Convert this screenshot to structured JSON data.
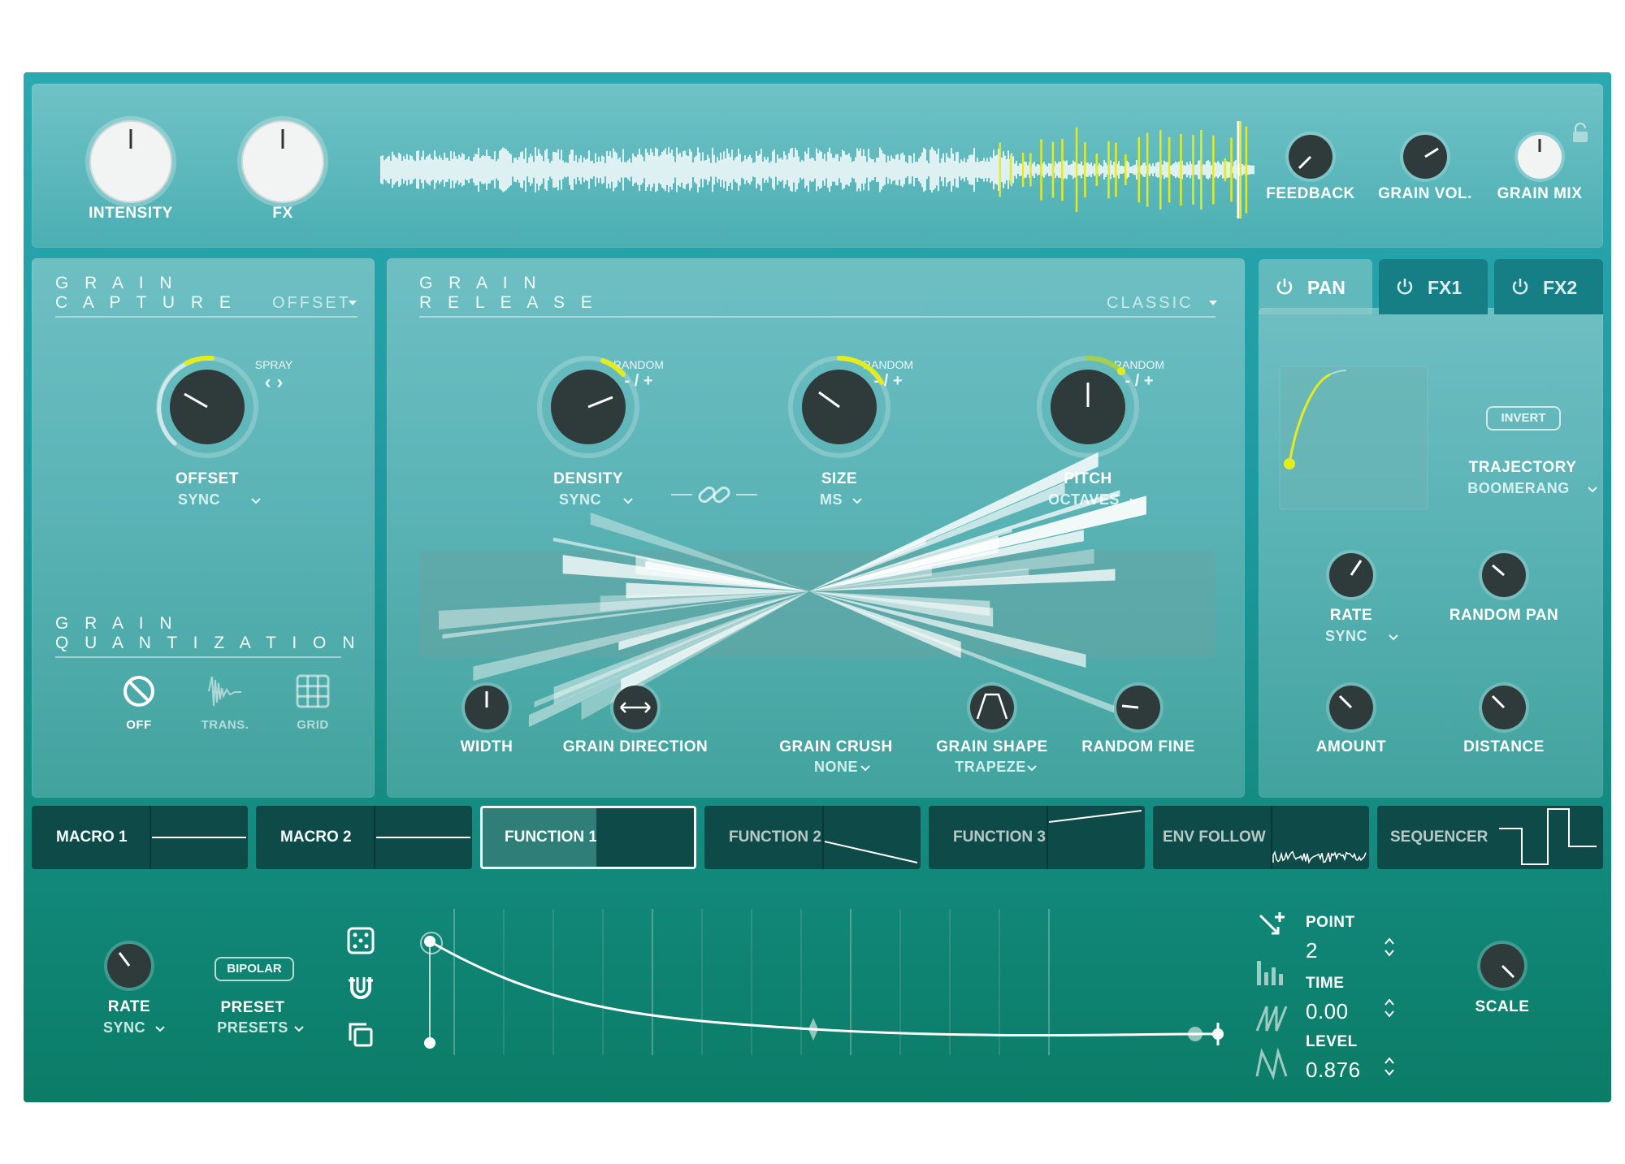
{
  "top": {
    "knobs_left": [
      {
        "label": "INTENSITY"
      },
      {
        "label": "FX"
      }
    ],
    "knobs_right": [
      {
        "label": "FEEDBACK"
      },
      {
        "label": "GRAIN VOL."
      },
      {
        "label": "GRAIN MIX"
      }
    ]
  },
  "capture": {
    "title_1": "G R A I N",
    "title_2": "C A P T U R E",
    "mode": "OFFSET",
    "spray_label": "SPRAY",
    "spray_arrows": "‹ ›",
    "offset_label": "OFFSET",
    "offset_sub": "SYNC",
    "quant_title_1": "G R A I N",
    "quant_title_2": "Q U A N T I Z A T I O N",
    "quant_options": [
      {
        "label": "OFF"
      },
      {
        "label": "TRANS."
      },
      {
        "label": "GRID"
      }
    ]
  },
  "release": {
    "title_1": "G R A I N",
    "title_2": "R E L E A S E",
    "mode": "CLASSIC",
    "random_label": "RANDOM",
    "random_value": "- / +",
    "knobs": [
      {
        "label": "DENSITY",
        "sub": "SYNC"
      },
      {
        "label": "SIZE",
        "sub": "MS"
      },
      {
        "label": "PITCH",
        "sub": "OCTAVES"
      }
    ],
    "bottom": [
      {
        "label": "WIDTH",
        "sub": ""
      },
      {
        "label": "GRAIN DIRECTION",
        "sub": ""
      },
      {
        "label": "GRAIN CRUSH",
        "sub": "NONE"
      },
      {
        "label": "GRAIN SHAPE",
        "sub": "TRAPEZE"
      },
      {
        "label": "RANDOM FINE",
        "sub": ""
      }
    ]
  },
  "pan": {
    "tabs": [
      {
        "label": "PAN"
      },
      {
        "label": "FX1"
      },
      {
        "label": "FX2"
      }
    ],
    "invert_label": "INVERT",
    "trajectory_label": "TRAJECTORY",
    "trajectory_value": "BOOMERANG",
    "knobs": [
      {
        "label": "RATE",
        "sub": "SYNC"
      },
      {
        "label": "RANDOM PAN",
        "sub": ""
      },
      {
        "label": "AMOUNT",
        "sub": ""
      },
      {
        "label": "DISTANCE",
        "sub": ""
      }
    ]
  },
  "mod_tabs": [
    {
      "label": "MACRO 1"
    },
    {
      "label": "MACRO 2"
    },
    {
      "label": "FUNCTION 1"
    },
    {
      "label": "FUNCTION 2"
    },
    {
      "label": "FUNCTION 3"
    },
    {
      "label": "ENV FOLLOW"
    },
    {
      "label": "SEQUENCER"
    }
  ],
  "function": {
    "rate_label": "RATE",
    "rate_sub": "SYNC",
    "bipolar_label": "BIPOLAR",
    "preset_label": "PRESET",
    "preset_sub": "PRESETS",
    "point_label": "POINT",
    "point_value": "2",
    "time_label": "TIME",
    "time_value": "0.00",
    "level_label": "LEVEL",
    "level_value": "0.876",
    "scale_label": "SCALE"
  },
  "colors": {
    "accent_yellow": "#e4ec1e",
    "dark_teal": "#0d4a48",
    "knob_dark": "#2f3a3a"
  }
}
